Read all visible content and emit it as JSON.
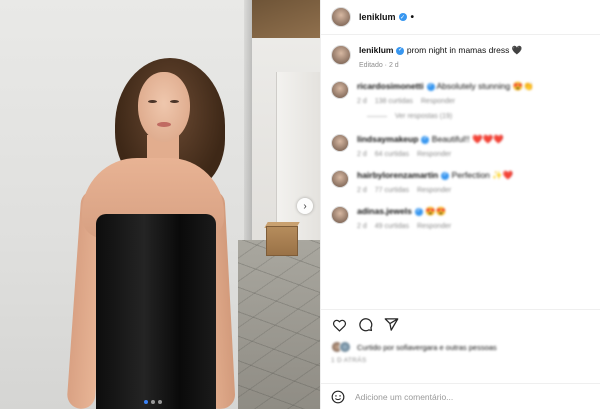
{
  "post": {
    "author": "leniklum",
    "more_glyph": "•",
    "caption": "prom night in mamas dress",
    "caption_emoji": "🖤",
    "edited": "Editado · 2 d"
  },
  "comments": [
    {
      "user": "ricardosimonetti",
      "text": "Absolutely stunning",
      "emoji": "😍👏",
      "age": "2 d",
      "likes": "138 curtidas",
      "reply": "Responder",
      "view_replies": "Ver respostas (19)"
    },
    {
      "user": "lindsaymakeup",
      "text": "Beautiful!!",
      "emoji": "❤️❤️❤️",
      "age": "2 d",
      "likes": "64 curtidas",
      "reply": "Responder"
    },
    {
      "user": "hairbylorenzamartin",
      "text": "Perfection",
      "emoji": "✨❤️",
      "age": "2 d",
      "likes": "77 curtidas",
      "reply": "Responder"
    },
    {
      "user": "adinas.jewels",
      "text": "",
      "emoji": "😍😍",
      "age": "2 d",
      "likes": "49 curtidas",
      "reply": "Responder"
    }
  ],
  "actions": {
    "like_icon": "heart-icon",
    "comment_icon": "comment-icon",
    "share_icon": "share-icon"
  },
  "likes_summary": "Curtido por sofiavergara e outras pessoas",
  "post_date": "1 D ATRÁS",
  "add_comment": {
    "placeholder": "Adicione um comentário..."
  },
  "carousel": {
    "next_glyph": "›",
    "slides": 3,
    "active": 1
  },
  "colors": {
    "verified": "#3897f0",
    "active_dot": "#3b82f6"
  }
}
